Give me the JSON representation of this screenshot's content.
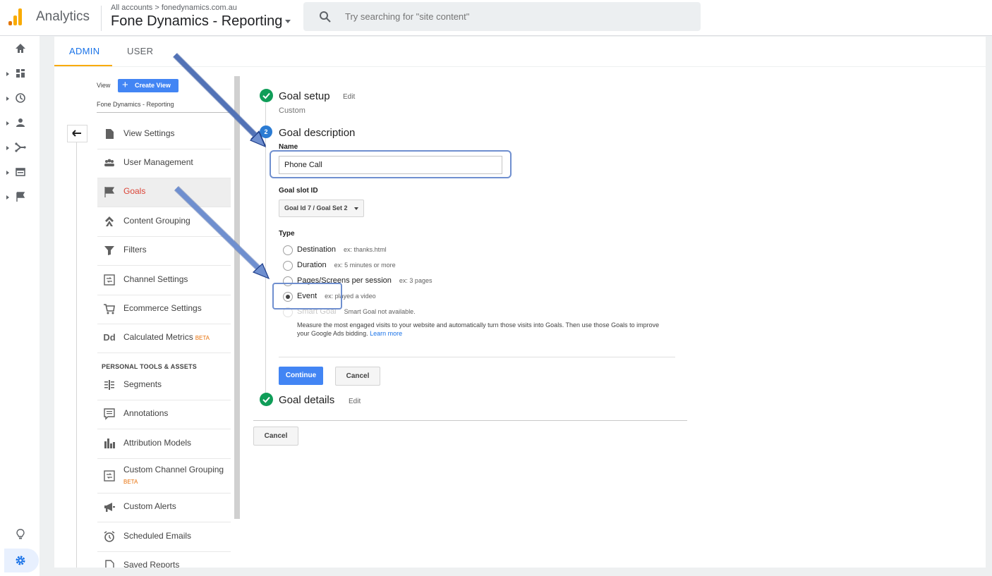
{
  "app": {
    "brand": "Analytics"
  },
  "header": {
    "breadcrumb": "All accounts > fonedynamics.com.au",
    "property_title": "Fone Dynamics - Reporting",
    "search_placeholder": "Try searching for \"site content\""
  },
  "tabs": [
    {
      "label": "ADMIN",
      "active": true
    },
    {
      "label": "USER",
      "active": false
    }
  ],
  "view_column": {
    "view_label": "View",
    "create_view_label": "Create View",
    "view_name": "Fone Dynamics - Reporting",
    "items": [
      {
        "label": "View Settings",
        "icon": "document-icon"
      },
      {
        "label": "User Management",
        "icon": "people-icon"
      },
      {
        "label": "Goals",
        "icon": "flag-icon",
        "active": true
      },
      {
        "label": "Content Grouping",
        "icon": "grouping-icon"
      },
      {
        "label": "Filters",
        "icon": "filter-icon"
      },
      {
        "label": "Channel Settings",
        "icon": "channel-icon"
      },
      {
        "label": "Ecommerce Settings",
        "icon": "cart-icon"
      },
      {
        "label": "Calculated Metrics",
        "icon": "dd-icon",
        "badge": "BETA"
      }
    ],
    "section_header": "PERSONAL TOOLS & ASSETS",
    "personal_items": [
      {
        "label": "Segments",
        "icon": "segments-icon"
      },
      {
        "label": "Annotations",
        "icon": "annotation-icon"
      },
      {
        "label": "Attribution Models",
        "icon": "bars-icon"
      },
      {
        "label": "Custom Channel Grouping",
        "icon": "channel-icon",
        "badge": "BETA"
      },
      {
        "label": "Custom Alerts",
        "icon": "megaphone-icon"
      },
      {
        "label": "Scheduled Emails",
        "icon": "alarm-icon"
      },
      {
        "label": "Saved Reports",
        "icon": "saved-report-icon"
      }
    ]
  },
  "goal_form": {
    "setup": {
      "title": "Goal setup",
      "edit": "Edit",
      "value": "Custom"
    },
    "description": {
      "step_number": "2",
      "title": "Goal description",
      "name_label": "Name",
      "name_value": "Phone Call",
      "slot_label": "Goal slot ID",
      "slot_value": "Goal Id 7 / Goal Set 2",
      "type_label": "Type",
      "types": [
        {
          "label": "Destination",
          "example": "ex: thanks.html",
          "selected": false
        },
        {
          "label": "Duration",
          "example": "ex: 5 minutes or more",
          "selected": false
        },
        {
          "label": "Pages/Screens per session",
          "example": "ex: 3 pages",
          "selected": false
        },
        {
          "label": "Event",
          "example": "ex: played a video",
          "selected": true
        },
        {
          "label": "Smart Goal",
          "example": "Smart Goal not available.",
          "selected": false,
          "disabled": true
        }
      ],
      "smart_goal_note": "Measure the most engaged visits to your website and automatically turn those visits into Goals. Then use those Goals to improve your Google Ads bidding.",
      "learn_more": "Learn more",
      "continue_label": "Continue",
      "cancel_label": "Cancel"
    },
    "details": {
      "title": "Goal details",
      "edit": "Edit"
    },
    "cancel_label": "Cancel"
  },
  "colors": {
    "accent": "#4285f4",
    "orange": "#f9ab00",
    "active_red": "#db4437",
    "success": "#0f9d58",
    "annotation": "#6f8fcf"
  }
}
